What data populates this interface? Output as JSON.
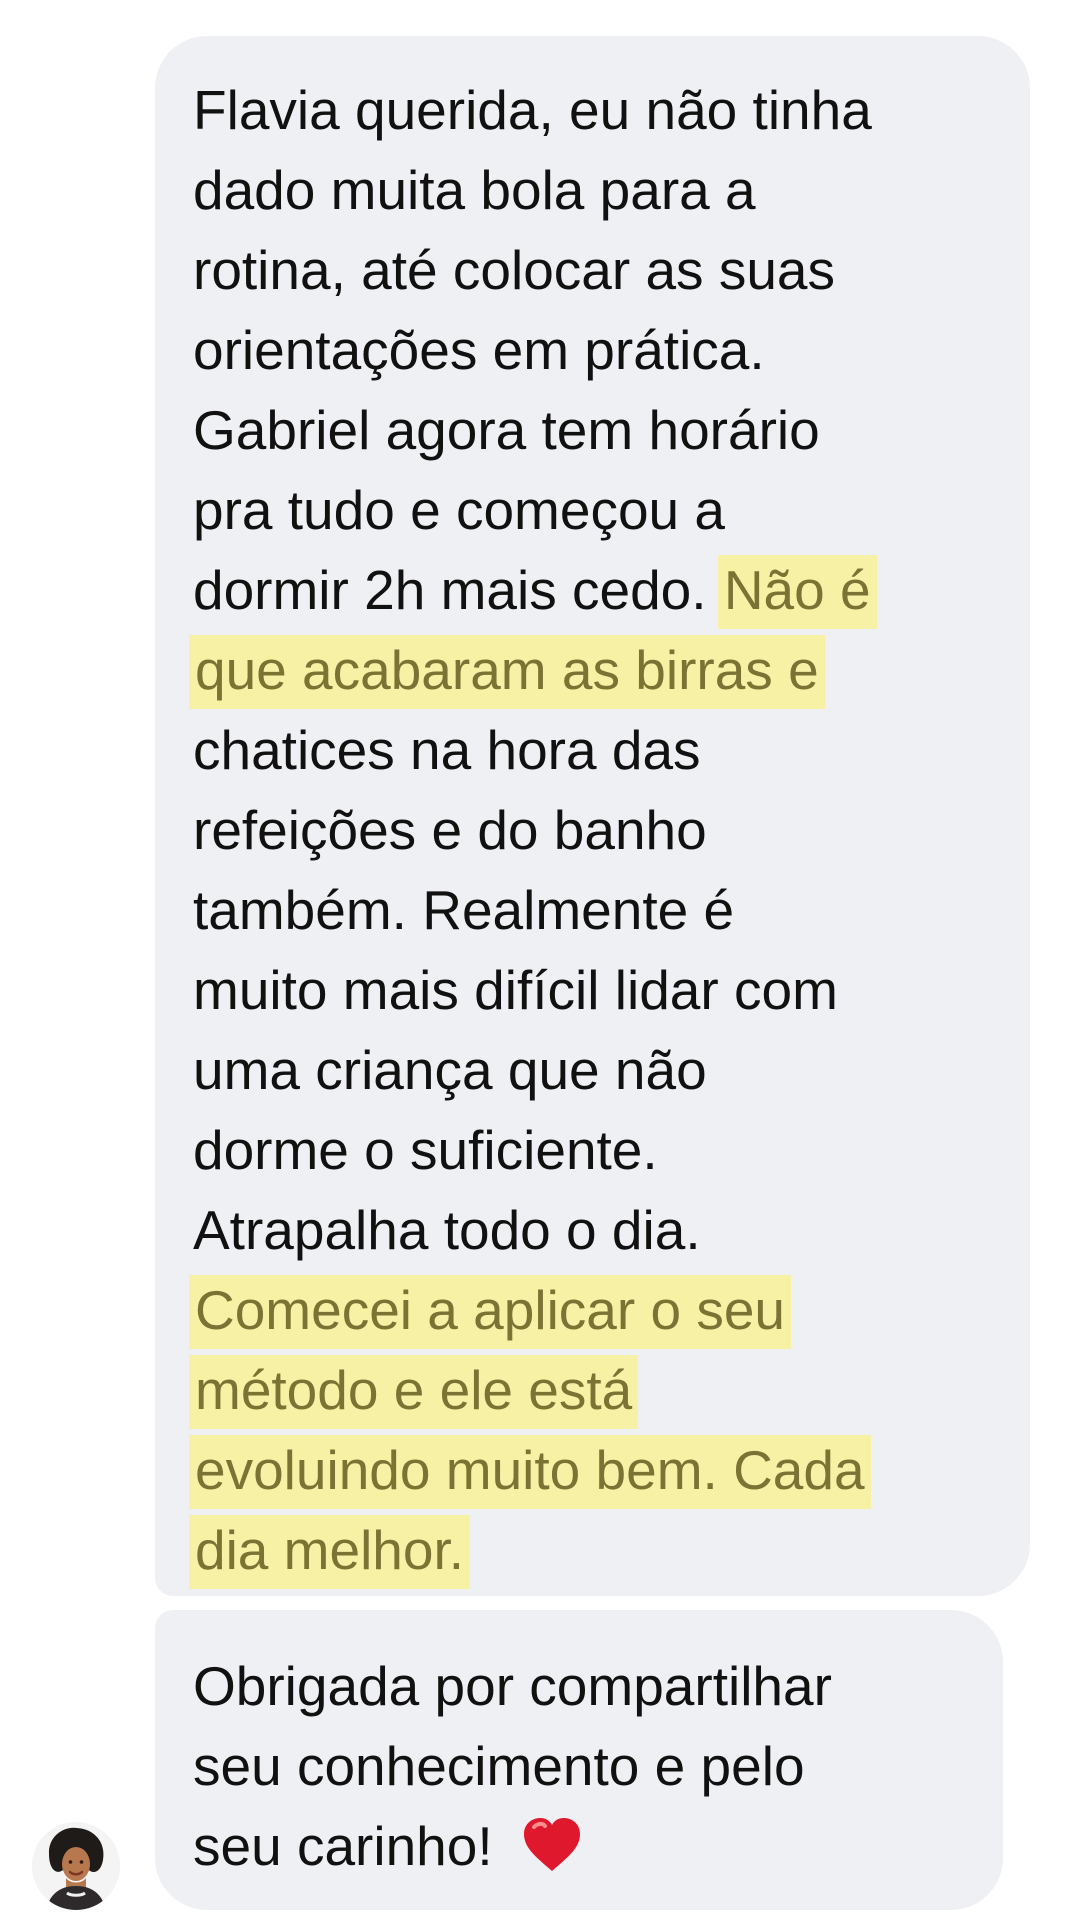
{
  "messages": [
    {
      "lines": [
        "Flavia querida, eu não tinha",
        "dado muita bola para a",
        "rotina, até colocar as suas",
        "orientações em prática.",
        "Gabriel agora tem horário",
        "pra tudo e começou a",
        "dormir 2h mais cedo.",
        "Não é",
        "que acabaram as birras e",
        "chatices na hora das",
        "refeições e do banho",
        "também. Realmente é",
        "muito mais difícil lidar com",
        "uma criança que não",
        "dorme o suficiente.",
        "Atrapalha todo o dia.",
        "Comecei a aplicar o seu",
        "método e ele está",
        "evoluindo muito bem. Cada",
        "dia melhor."
      ],
      "highlight_color": "#f7f1a5",
      "highlight_text_color": "#7a7333"
    },
    {
      "lines": [
        "Obrigada por compartilhar",
        "seu conhecimento e pelo",
        "seu carinho!"
      ],
      "emoji": "heart-emoji"
    }
  ],
  "avatar": {
    "icon": "user-avatar"
  },
  "colors": {
    "bubble": "#eff0f3",
    "text": "#111111",
    "heart": "#e0182d"
  }
}
